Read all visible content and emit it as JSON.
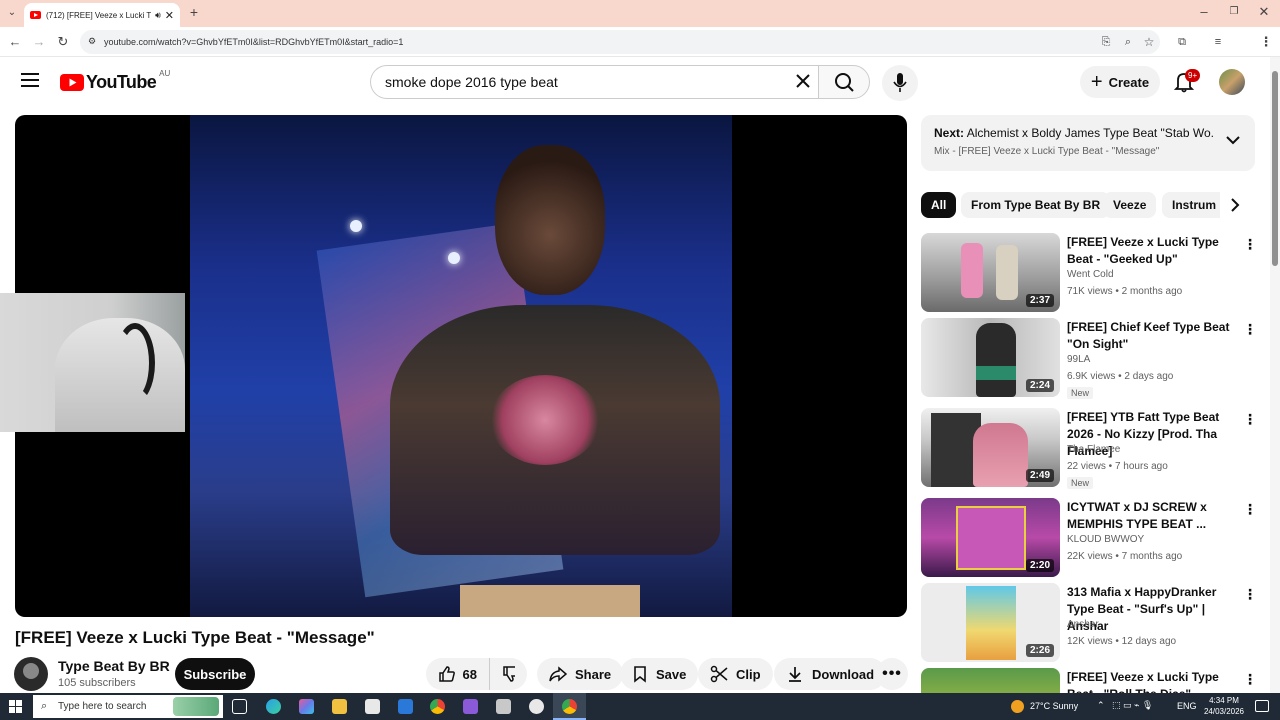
{
  "browser": {
    "tab_title": "(712) [FREE] Veeze x Lucki T",
    "new_tab_symbol": "+",
    "url": "youtube.com/watch?v=GhvbYfETm0I&list=RDGhvbYfETm0I&start_radio=1"
  },
  "header": {
    "logo_text": "YouTube",
    "region": "AU",
    "search_value": "smoke dope 2016 type beat",
    "create_label": "Create",
    "notification_count": "9+"
  },
  "video": {
    "title": "[FREE] Veeze x Lucki Type Beat - \"Message\"",
    "channel_name": "Type Beat By BR",
    "subscribers": "105 subscribers",
    "subscribe_label": "Subscribe",
    "like_count": "68",
    "share_label": "Share",
    "save_label": "Save",
    "clip_label": "Clip",
    "download_label": "Download"
  },
  "next_up": {
    "prefix": "Next:",
    "title": "Alchemist x Boldy James Type Beat \"Stab Wo...",
    "playlist": "Mix - [FREE] Veeze x Lucki Type Beat - \"Message\""
  },
  "chips": [
    "All",
    "From Type Beat By BR",
    "Veeze",
    "Instrum"
  ],
  "recommendations": [
    {
      "title": "[FREE] Veeze x Lucki Type Beat - \"Geeked Up\"",
      "channel": "Went Cold",
      "meta": "71K views • 2 months ago",
      "duration": "2:37",
      "badge": ""
    },
    {
      "title": "[FREE] Chief Keef Type Beat \"On Sight\"",
      "channel": "99LA",
      "meta": "6.9K views • 2 days ago",
      "duration": "2:24",
      "badge": "New"
    },
    {
      "title": "[FREE] YTB Fatt Type Beat 2026 - No Kizzy [Prod. Tha Flamee]",
      "channel": "Tha Flamee",
      "meta": "22 views • 7 hours ago",
      "duration": "2:49",
      "badge": "New"
    },
    {
      "title": "ICYTWAT x DJ SCREW x MEMPHIS TYPE BEAT ...",
      "channel": "KLOUD BWWOY",
      "meta": "22K views • 7 months ago",
      "duration": "2:20",
      "badge": ""
    },
    {
      "title": "313 Mafia x HappyDranker Type Beat - \"Surf's Up\" | Anshar",
      "channel": "Anshar",
      "meta": "12K views • 12 days ago",
      "duration": "2:26",
      "badge": ""
    },
    {
      "title": "[FREE] Veeze x Lucki Type Beat - \"Roll The Dice\"",
      "channel": "",
      "meta": "",
      "duration": "",
      "badge": ""
    }
  ],
  "taskbar": {
    "search_placeholder": "Type here to search",
    "weather": "27°C  Sunny",
    "language": "ENG",
    "time": "4:34 PM",
    "date": "24/03/2026"
  },
  "colors": {
    "youtube_red": "#ff0000",
    "tab_bar": "#f8d7cd",
    "taskbar": "#1f2a36"
  }
}
